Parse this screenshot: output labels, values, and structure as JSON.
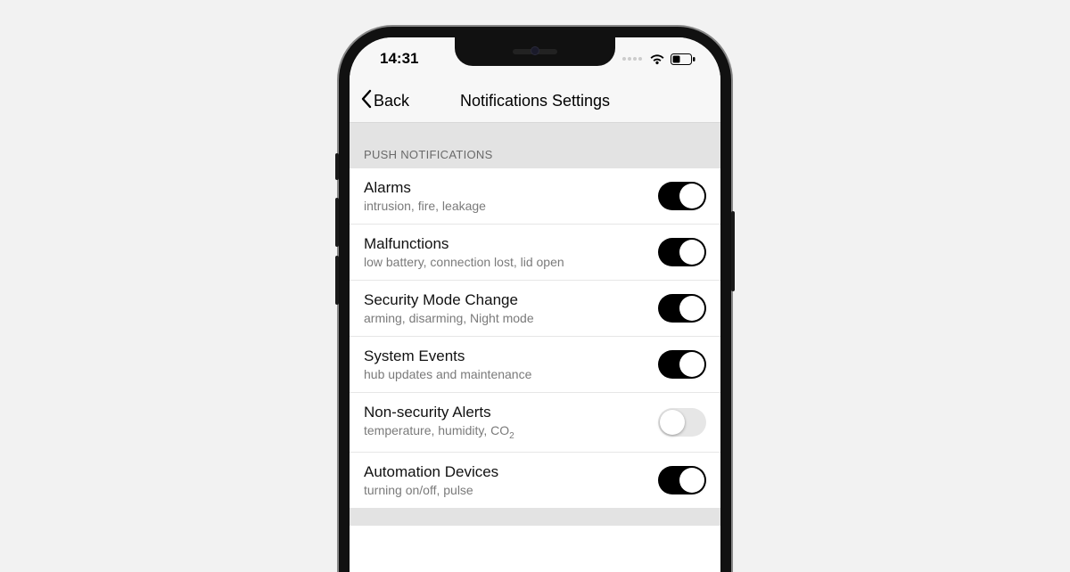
{
  "status": {
    "time": "14:31"
  },
  "nav": {
    "back_label": "Back",
    "title": "Notifications Settings"
  },
  "section": {
    "header": "PUSH NOTIFICATIONS"
  },
  "items": [
    {
      "title": "Alarms",
      "sub": "intrusion, fire, leakage",
      "on": true
    },
    {
      "title": "Malfunctions",
      "sub": "low battery, connection lost, lid open",
      "on": true
    },
    {
      "title": "Security Mode Change",
      "sub": "arming, disarming, Night mode",
      "on": true
    },
    {
      "title": "System Events",
      "sub": "hub updates and maintenance",
      "on": true
    },
    {
      "title": "Non-security Alerts",
      "sub": "temperature, humidity, CO",
      "sub_suffix": "2",
      "on": false
    },
    {
      "title": "Automation Devices",
      "sub": "turning on/off, pulse",
      "on": true
    }
  ]
}
